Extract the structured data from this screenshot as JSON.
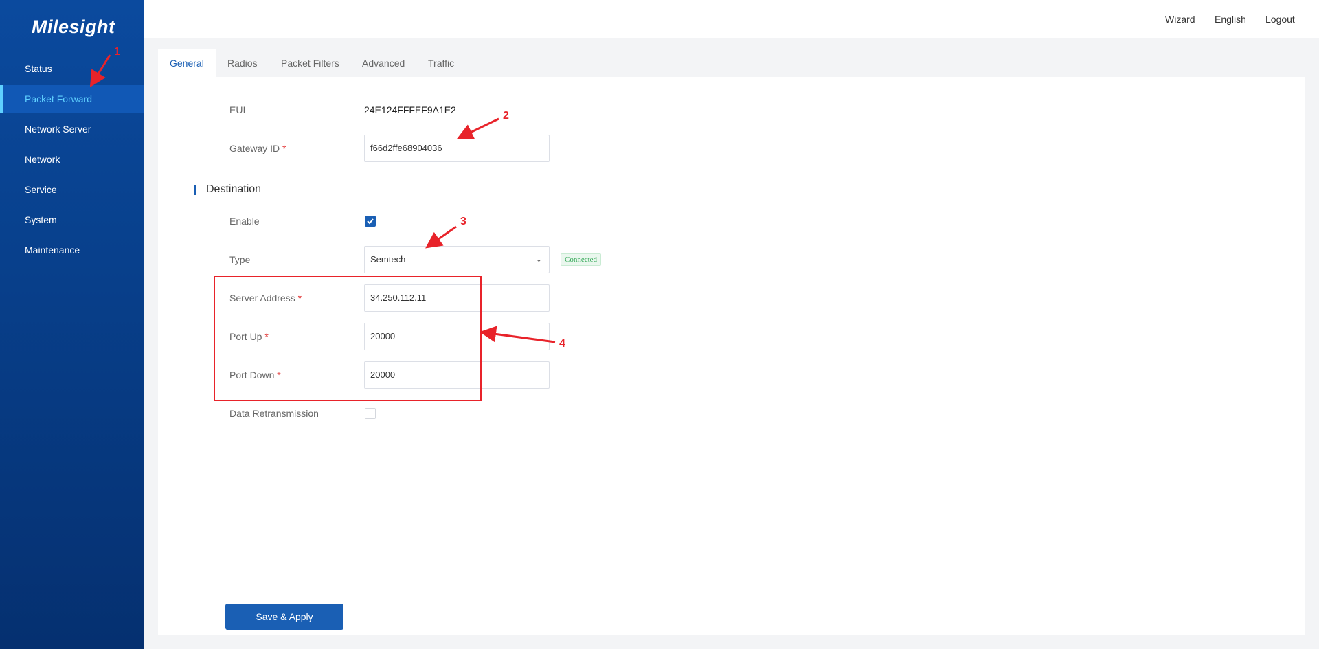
{
  "brand": {
    "logo": "Milesight"
  },
  "sidebar": {
    "items": [
      {
        "label": "Status"
      },
      {
        "label": "Packet Forward"
      },
      {
        "label": "Network Server"
      },
      {
        "label": "Network"
      },
      {
        "label": "Service"
      },
      {
        "label": "System"
      },
      {
        "label": "Maintenance"
      }
    ],
    "active_label": "Packet Forward"
  },
  "header": {
    "wizard": "Wizard",
    "language": "English",
    "logout": "Logout"
  },
  "tabs": [
    {
      "label": "General"
    },
    {
      "label": "Radios"
    },
    {
      "label": "Packet Filters"
    },
    {
      "label": "Advanced"
    },
    {
      "label": "Traffic"
    }
  ],
  "active_tab": "General",
  "form": {
    "eui": {
      "label": "EUI",
      "value": "24E124FFFEF9A1E2"
    },
    "gateway_id": {
      "label": "Gateway ID",
      "value": "f66d2ffe68904036"
    },
    "destination": {
      "section_title": "Destination",
      "enable": {
        "label": "Enable",
        "checked": true
      },
      "type": {
        "label": "Type",
        "value": "Semtech",
        "status": "Connected"
      },
      "server_address": {
        "label": "Server Address",
        "value": "34.250.112.11"
      },
      "port_up": {
        "label": "Port Up",
        "value": "20000"
      },
      "port_down": {
        "label": "Port Down",
        "value": "20000"
      },
      "data_retransmission": {
        "label": "Data Retransmission",
        "checked": false
      }
    },
    "required_marker": "*"
  },
  "actions": {
    "save_apply": "Save & Apply"
  },
  "annotations": {
    "n1": "1",
    "n2": "2",
    "n3": "3",
    "n4": "4",
    "color": "#e8232a"
  },
  "colors": {
    "accent": "#1a5fb4",
    "sidebar": "#0b4a9e",
    "active_nav_text": "#5fd0ff",
    "status_green": "#2aa44f"
  }
}
